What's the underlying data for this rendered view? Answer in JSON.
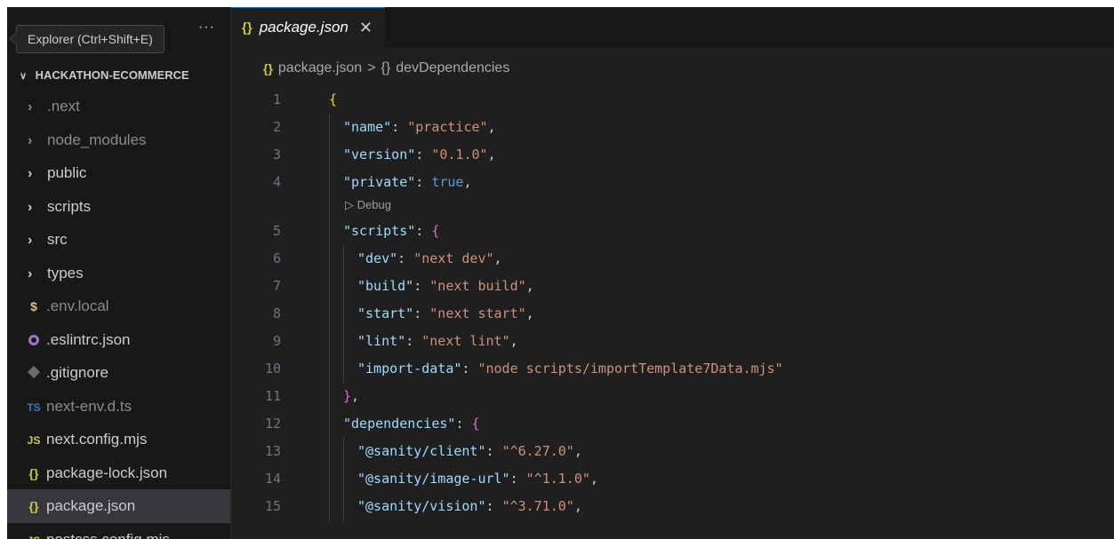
{
  "sidebar": {
    "tooltip": "Explorer (Ctrl+Shift+E)",
    "more_label": "···",
    "folder_title": "HACKATHON-ECOMMERCE",
    "items": [
      {
        "type": "folder",
        "label": ".next",
        "dim": true
      },
      {
        "type": "folder",
        "label": "node_modules",
        "dim": true
      },
      {
        "type": "folder",
        "label": "public",
        "dim": false
      },
      {
        "type": "folder",
        "label": "scripts",
        "dim": false
      },
      {
        "type": "folder",
        "label": "src",
        "dim": false
      },
      {
        "type": "folder",
        "label": "types",
        "dim": false
      },
      {
        "type": "file",
        "icon": "$",
        "icon_name": "env-icon",
        "label": ".env.local",
        "dim": true
      },
      {
        "type": "file",
        "icon": "eslint",
        "icon_name": "eslint-icon",
        "label": ".eslintrc.json",
        "dim": false
      },
      {
        "type": "file",
        "icon": "git",
        "icon_name": "git-icon",
        "label": ".gitignore",
        "dim": false
      },
      {
        "type": "file",
        "icon": "TS",
        "icon_name": "typescript-icon",
        "label": "next-env.d.ts",
        "dim": true
      },
      {
        "type": "file",
        "icon": "JS",
        "icon_name": "javascript-icon",
        "label": "next.config.mjs",
        "dim": false
      },
      {
        "type": "file",
        "icon": "{}",
        "icon_name": "json-icon",
        "label": "package-lock.json",
        "dim": false
      },
      {
        "type": "file",
        "icon": "{}",
        "icon_name": "json-icon",
        "label": "package.json",
        "dim": false,
        "selected": true
      },
      {
        "type": "file",
        "icon": "JS",
        "icon_name": "javascript-icon",
        "label": "postcss.config.mjs",
        "dim": false
      }
    ]
  },
  "editor": {
    "tab": {
      "icon": "{}",
      "label": "package.json",
      "close": "✕"
    },
    "breadcrumb": {
      "file_icon": "{}",
      "file": "package.json",
      "separator": ">",
      "node_icon": "{}",
      "node": "devDependencies"
    },
    "codelens_debug": "Debug",
    "lines": [
      {
        "n": "1",
        "indent": 0,
        "tokens": [
          {
            "t": "{",
            "c": "br1"
          }
        ]
      },
      {
        "n": "2",
        "indent": 1,
        "tokens": [
          {
            "t": "\"name\"",
            "c": "k"
          },
          {
            "t": ": ",
            "c": "p"
          },
          {
            "t": "\"practice\"",
            "c": "s"
          },
          {
            "t": ",",
            "c": "p"
          }
        ]
      },
      {
        "n": "3",
        "indent": 1,
        "tokens": [
          {
            "t": "\"version\"",
            "c": "k"
          },
          {
            "t": ": ",
            "c": "p"
          },
          {
            "t": "\"0.1.0\"",
            "c": "s"
          },
          {
            "t": ",",
            "c": "p"
          }
        ]
      },
      {
        "n": "4",
        "indent": 1,
        "tokens": [
          {
            "t": "\"private\"",
            "c": "k"
          },
          {
            "t": ": ",
            "c": "p"
          },
          {
            "t": "true",
            "c": "b"
          },
          {
            "t": ",",
            "c": "p"
          }
        ],
        "codelens_after": true
      },
      {
        "n": "5",
        "indent": 1,
        "tokens": [
          {
            "t": "\"scripts\"",
            "c": "k"
          },
          {
            "t": ": ",
            "c": "p"
          },
          {
            "t": "{",
            "c": "br2"
          }
        ]
      },
      {
        "n": "6",
        "indent": 2,
        "tokens": [
          {
            "t": "\"dev\"",
            "c": "k"
          },
          {
            "t": ": ",
            "c": "p"
          },
          {
            "t": "\"next dev\"",
            "c": "s"
          },
          {
            "t": ",",
            "c": "p"
          }
        ]
      },
      {
        "n": "7",
        "indent": 2,
        "tokens": [
          {
            "t": "\"build\"",
            "c": "k"
          },
          {
            "t": ": ",
            "c": "p"
          },
          {
            "t": "\"next build\"",
            "c": "s"
          },
          {
            "t": ",",
            "c": "p"
          }
        ]
      },
      {
        "n": "8",
        "indent": 2,
        "tokens": [
          {
            "t": "\"start\"",
            "c": "k"
          },
          {
            "t": ": ",
            "c": "p"
          },
          {
            "t": "\"next start\"",
            "c": "s"
          },
          {
            "t": ",",
            "c": "p"
          }
        ]
      },
      {
        "n": "9",
        "indent": 2,
        "tokens": [
          {
            "t": "\"lint\"",
            "c": "k"
          },
          {
            "t": ": ",
            "c": "p"
          },
          {
            "t": "\"next lint\"",
            "c": "s"
          },
          {
            "t": ",",
            "c": "p"
          }
        ]
      },
      {
        "n": "10",
        "indent": 2,
        "tokens": [
          {
            "t": "\"import-data\"",
            "c": "k"
          },
          {
            "t": ": ",
            "c": "p"
          },
          {
            "t": "\"node scripts/importTemplate7Data.mjs\"",
            "c": "s"
          }
        ]
      },
      {
        "n": "11",
        "indent": 1,
        "tokens": [
          {
            "t": "}",
            "c": "br2"
          },
          {
            "t": ",",
            "c": "p"
          }
        ]
      },
      {
        "n": "12",
        "indent": 1,
        "tokens": [
          {
            "t": "\"dependencies\"",
            "c": "k"
          },
          {
            "t": ": ",
            "c": "p"
          },
          {
            "t": "{",
            "c": "br2"
          }
        ]
      },
      {
        "n": "13",
        "indent": 2,
        "tokens": [
          {
            "t": "\"@sanity/client\"",
            "c": "k"
          },
          {
            "t": ": ",
            "c": "p"
          },
          {
            "t": "\"^6.27.0\"",
            "c": "s"
          },
          {
            "t": ",",
            "c": "p"
          }
        ]
      },
      {
        "n": "14",
        "indent": 2,
        "tokens": [
          {
            "t": "\"@sanity/image-url\"",
            "c": "k"
          },
          {
            "t": ": ",
            "c": "p"
          },
          {
            "t": "\"^1.1.0\"",
            "c": "s"
          },
          {
            "t": ",",
            "c": "p"
          }
        ]
      },
      {
        "n": "15",
        "indent": 2,
        "tokens": [
          {
            "t": "\"@sanity/vision\"",
            "c": "k"
          },
          {
            "t": ": ",
            "c": "p"
          },
          {
            "t": "\"^3.71.0\"",
            "c": "s"
          },
          {
            "t": ",",
            "c": "p"
          }
        ]
      }
    ]
  },
  "colors": {
    "background": "#1f1f1f",
    "sidebar": "#181818",
    "selected_row": "#37373d",
    "key": "#9cdcfe",
    "string": "#ce9178",
    "boolean": "#569cd6",
    "bracket_outer": "#ffd700",
    "bracket_inner": "#da70d6"
  }
}
